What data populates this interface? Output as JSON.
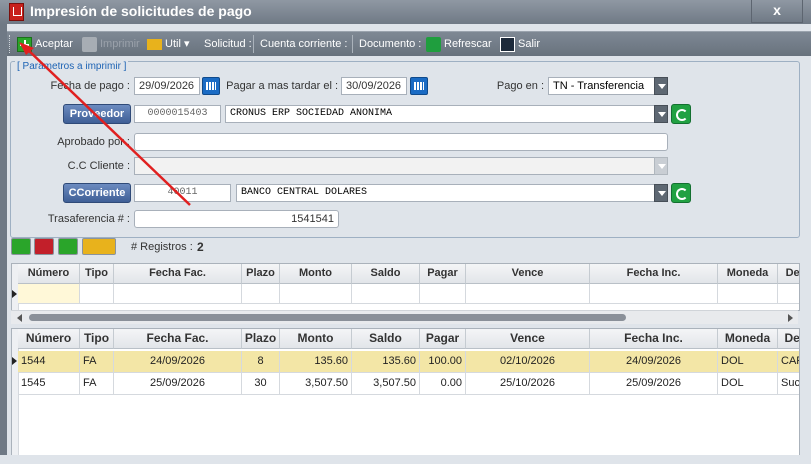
{
  "window": {
    "title": "Impresión de solicitudes de pago",
    "close_label": "x"
  },
  "toolbar": {
    "aceptar": "Aceptar",
    "imprimir": "Imprimir",
    "util": "Util",
    "solicitud": "Solicitud :",
    "cuenta_corriente": "Cuenta corriente :",
    "documento": "Documento :",
    "refrescar": "Refrescar",
    "salir": "Salir"
  },
  "params": {
    "legend": "[ Parámetros a imprimir ]",
    "fecha_pago_label": "Fecha de pago :",
    "fecha_pago": "29/09/2026",
    "pagar_label": "Pagar a mas tardar el :",
    "pagar": "30/09/2026",
    "pago_en_label": "Pago en :",
    "pago_en": "TN - Transferencia",
    "proveedor_btn": "Proveedor",
    "proveedor_code": "0000015403",
    "proveedor_name": "CRONUS ERP SOCIEDAD ANONIMA",
    "aprobado_label": "Aprobado por :",
    "aprobado": "",
    "cc_cliente_label": "C.C Cliente :",
    "cc_cliente": "",
    "ccorriente_btn": "CCorriente",
    "ccorriente_code": "40011",
    "ccorriente_name": "BANCO CENTRAL DOLARES",
    "transferencia_label": "Trasaferencia # :",
    "transferencia": "1541541"
  },
  "registros": {
    "label": "# Registros :",
    "count": "2"
  },
  "columns": [
    "Número",
    "Tipo",
    "Fecha Fac.",
    "Plazo",
    "Monto",
    "Saldo",
    "Pagar",
    "Vence",
    "Fecha Inc.",
    "Moneda",
    "Deta"
  ],
  "rows": [
    {
      "numero": "1544",
      "tipo": "FA",
      "fecha_fac": "24/09/2026",
      "plazo": "8",
      "monto": "135.60",
      "saldo": "135.60",
      "pagar": "100.00",
      "vence": "02/10/2026",
      "fecha_inc": "24/09/2026",
      "moneda": "DOL",
      "detalle": "CAPA"
    },
    {
      "numero": "1545",
      "tipo": "FA",
      "fecha_fac": "25/09/2026",
      "plazo": "30",
      "monto": "3,507.50",
      "saldo": "3,507.50",
      "pagar": "0.00",
      "vence": "25/10/2026",
      "fecha_inc": "25/09/2026",
      "moneda": "DOL",
      "detalle": "Sucur"
    }
  ],
  "colors": {
    "selected_row": "#f3e6a6",
    "accent": "#1a6bc4",
    "annotation_arrow": "#e02020"
  }
}
